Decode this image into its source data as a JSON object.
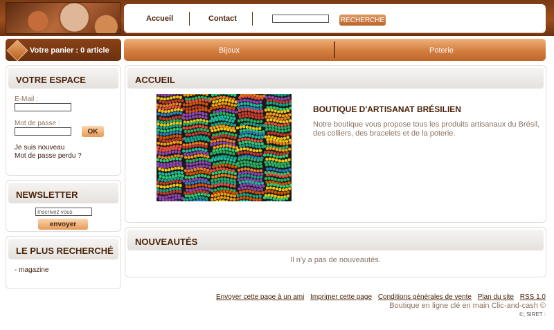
{
  "header": {
    "nav": {
      "home": "Accueil",
      "contact": "Contact"
    },
    "search": {
      "button": "RECHERCHE",
      "placeholder": ""
    }
  },
  "cart": {
    "label": "Votre panier : 0 article"
  },
  "categories": [
    "Bijoux",
    "Poterie"
  ],
  "sidebar": {
    "account": {
      "title": "VOTRE ESPACE",
      "email_label": "E-Mail :",
      "password_label": "Mot de passe :",
      "ok_button": "OK",
      "new_user": "Je suis nouveau",
      "forgot_password": "Mot de passe perdu ?"
    },
    "newsletter": {
      "title": "NEWSLETTER",
      "input_value": "Inscrivez vous",
      "send_button": "envoyer"
    },
    "popular": {
      "title": "LE PLUS RECHERCHÉ",
      "items": [
        "- magazine"
      ]
    }
  },
  "main": {
    "home": {
      "title": "ACCUEIL",
      "shop_title": "BOUTIQUE D'ARTISANAT BRÉSILIEN",
      "description": "Notre boutique vous propose tous les produits artisanaux du Brésil, des colliers, des bracelets et de la poterie."
    },
    "news": {
      "title": "NOUVEAUTÉS",
      "empty_text": "Il n'y a pas de nouveautés."
    }
  },
  "footer": {
    "links": [
      "Envoyer cette page à un ami",
      "Imprimer cette page",
      "Conditions générales de vente",
      "Plan du site",
      "RSS 1.0"
    ],
    "credit": "Boutique en ligne clé en main Clic-and-cash ©",
    "siret": "©, SIRET :"
  }
}
